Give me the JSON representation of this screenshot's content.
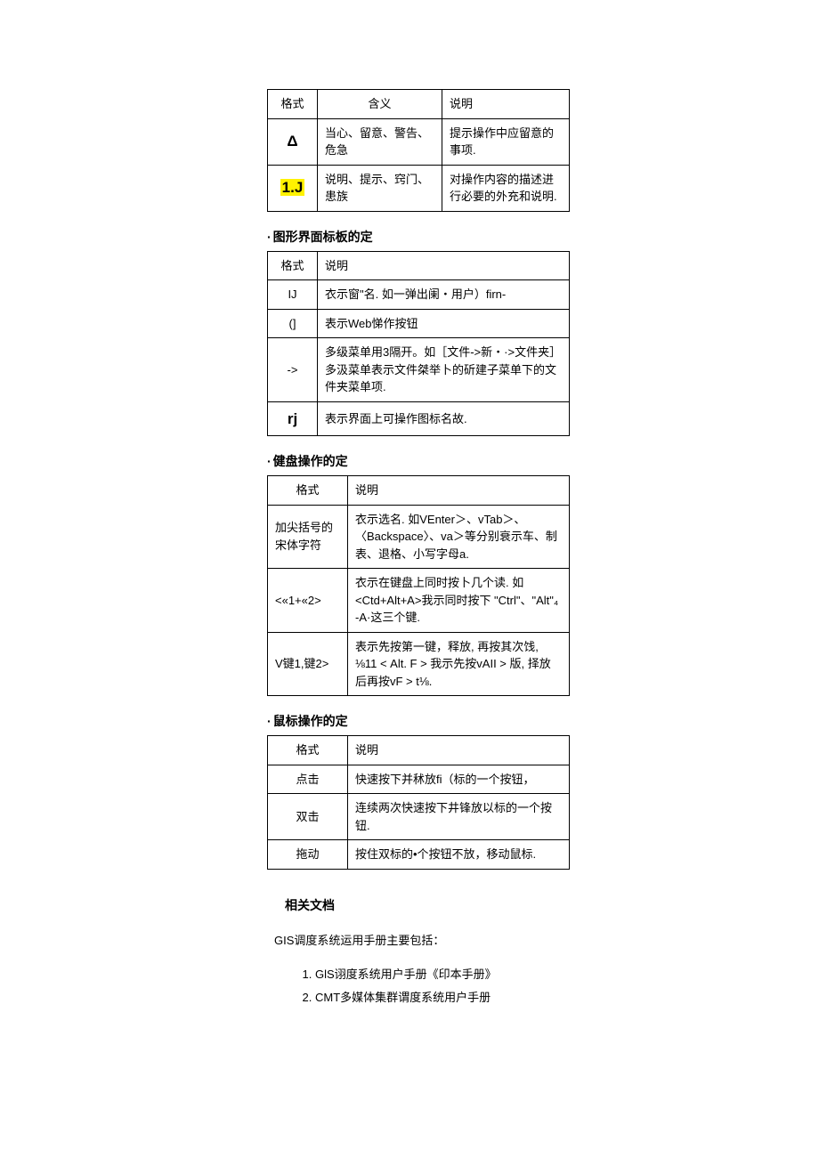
{
  "table1": {
    "h1": "格式",
    "h2": "含义",
    "h3": "说明",
    "r1c1": "Δ",
    "r1c2": "当心、留意、警告、危急",
    "r1c3": "提示操作中应留意的事项.",
    "r2c1": "1.J",
    "r2c2": "说明、提示、窍门、患族",
    "r2c3": "对操作内容的描述进行必要的外充和说明."
  },
  "sec2": {
    "title": "图形界面标板的定",
    "h1": "格式",
    "h2": "说明",
    "r1c1": "IJ",
    "r1c2": "衣示窗\"名. 如一弹出阑・用户）firn-",
    "r2c1": "(]",
    "r2c2": "表示Web悌作按钮",
    "r3c1": "->",
    "r3c2": "多级菜单用3隔开。如［文件->新・·>文件夹］多汲菜单表示文件桀举卜的斫建子菜单下的文件夹菜单项.",
    "r4c1": "rj",
    "r4c2": "表示界面上可操作图标名故."
  },
  "sec3": {
    "title": "健盘操作的定",
    "h1": "格式",
    "h2": "说明",
    "r1c1": "加尖括号的宋体字符",
    "r1c2": "衣示选名. 如VEnter＞、vTab＞、〈Backspace〉、va＞等分别衰示车、制表、退格、小写字母a.",
    "r2c1": "<«1+«2>",
    "r2c2": "衣示在键盘上同时按卜几个读. 如 <Ctd+Alt+A>我示同时按下 \"Ctrl\"、\"Alt\"₄ -A·这三个键.",
    "r3c1": "V键1,键2>",
    "r3c2": "表示先按第一键，释放, 再按其次饯, ⅛11 < Alt. F > 我示先按vAII > 版, 择放后再按vF > t⅛."
  },
  "sec4": {
    "title": "鼠标操作的定",
    "h1": "格式",
    "h2": "说明",
    "r1c1": "点击",
    "r1c2": "快速按下并秫放fi（标的一个按钮，",
    "r2c1": "双击",
    "r2c2": "连续两次快速按下井锋放以标的一个按钮.",
    "r3c1": "拖动",
    "r3c2": "按住双标的•个按钮不放，移动鼠标."
  },
  "related": {
    "heading": "相关文档",
    "intro": "GIS调度系统运用手册主要包括：",
    "item1": "GlS诩度系统用户手册《印本手册》",
    "item2": "CMT多媒体集群谓度系统用户手册"
  }
}
